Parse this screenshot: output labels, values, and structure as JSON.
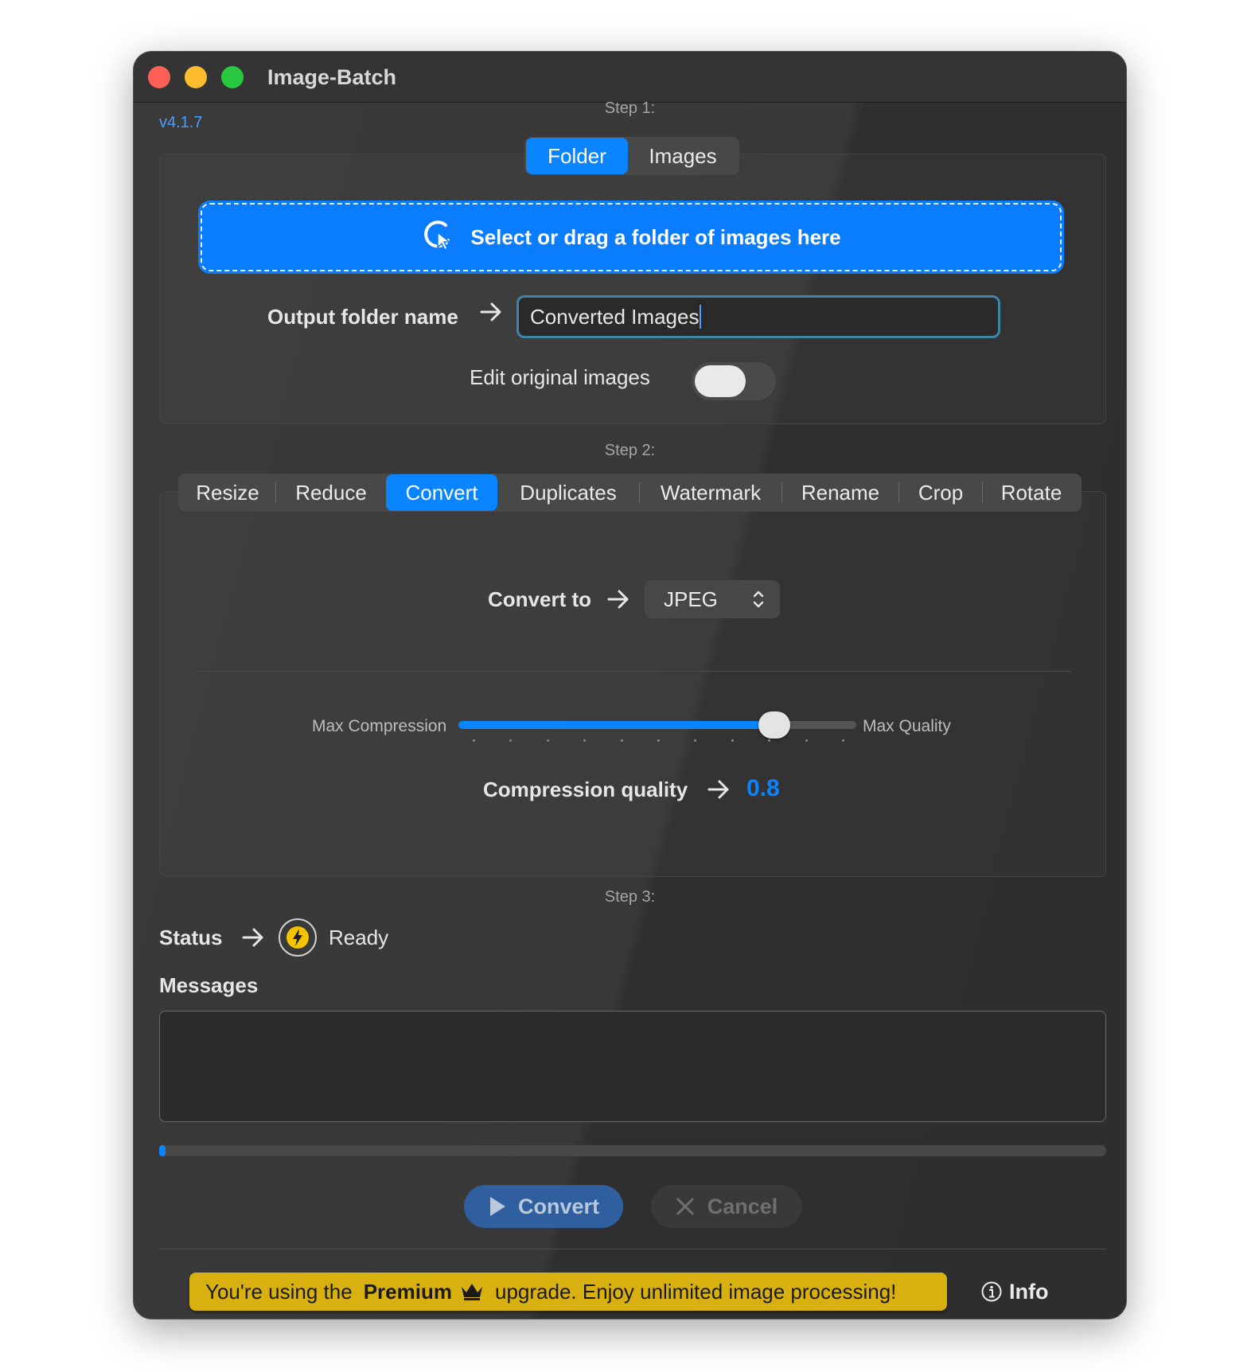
{
  "window": {
    "title": "Image-Batch",
    "version": "v4.1.7"
  },
  "step1": {
    "label": "Step 1:",
    "source_tabs": [
      {
        "label": "Folder",
        "active": true
      },
      {
        "label": "Images",
        "active": false
      }
    ],
    "dropzone_label": "Select or drag a folder of images here",
    "output_label": "Output folder name",
    "output_value": "Converted Images",
    "edit_original_label": "Edit original images",
    "edit_original_on": false
  },
  "step2": {
    "label": "Step 2:",
    "tabs": [
      {
        "label": "Resize",
        "active": false
      },
      {
        "label": "Reduce",
        "active": false
      },
      {
        "label": "Convert",
        "active": true
      },
      {
        "label": "Duplicates",
        "active": false
      },
      {
        "label": "Watermark",
        "active": false
      },
      {
        "label": "Rename",
        "active": false
      },
      {
        "label": "Crop",
        "active": false
      },
      {
        "label": "Rotate",
        "active": false
      }
    ],
    "convert_to_label": "Convert to",
    "format_value": "JPEG",
    "slider_min_label": "Max Compression",
    "slider_max_label": "Max Quality",
    "quality_label": "Compression quality",
    "quality_value": "0.8",
    "quality_fraction": 0.8
  },
  "step3": {
    "label": "Step 3:",
    "status_label": "Status",
    "status_value": "Ready",
    "messages_label": "Messages",
    "progress_fraction": 0.0
  },
  "actions": {
    "convert_label": "Convert",
    "cancel_label": "Cancel"
  },
  "footer": {
    "premium_prefix": "You're using the",
    "premium_word": "Premium",
    "premium_suffix": "upgrade. Enjoy unlimited image processing!",
    "info_label": "Info"
  },
  "colors": {
    "accent": "#0a84ff",
    "premium": "#d8b00f",
    "window_bg": "#323232"
  },
  "icons": {
    "dropzone": "pointer-click-icon",
    "status": "bolt-icon",
    "premium": "crown-icon",
    "info": "info-circle-icon"
  }
}
